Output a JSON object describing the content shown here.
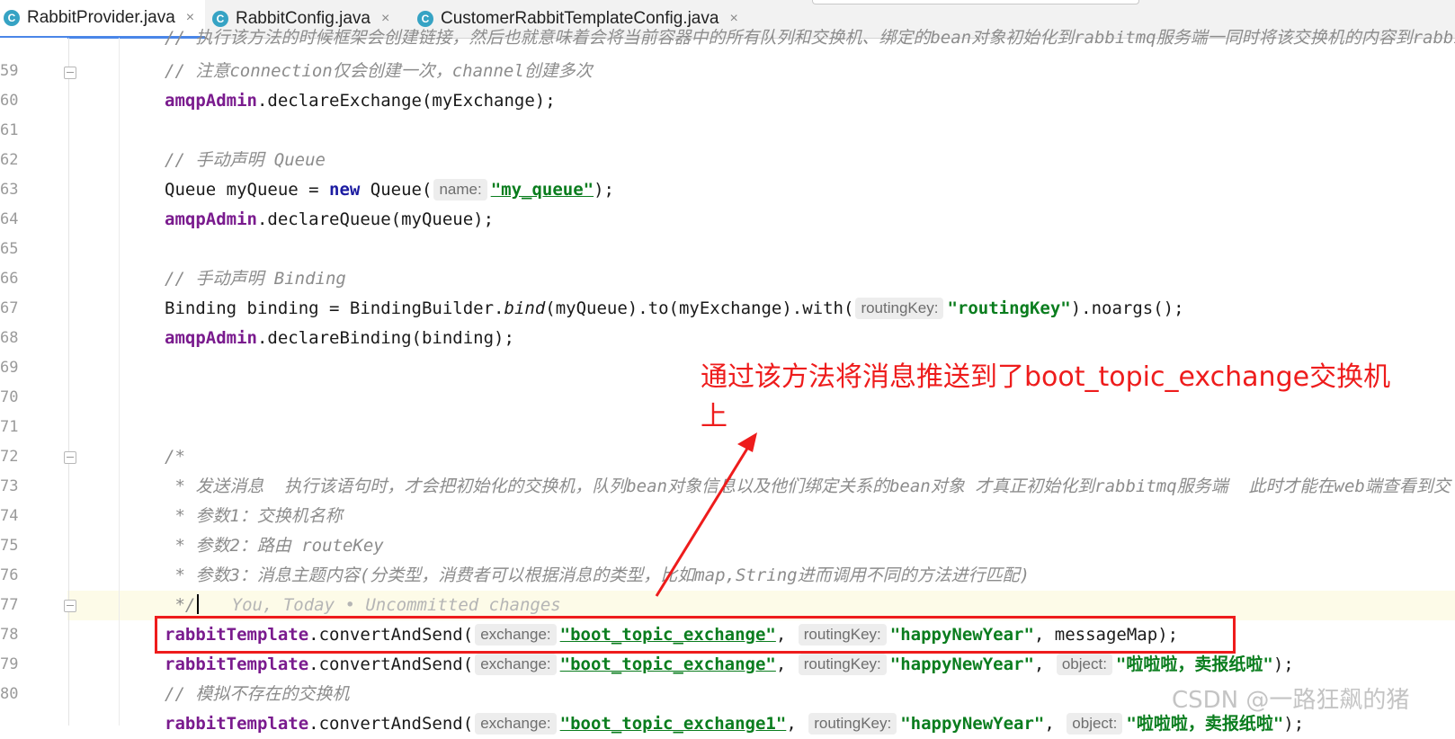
{
  "tabs": [
    {
      "label": "RabbitProvider.java",
      "active": true
    },
    {
      "label": "RabbitConfig.java",
      "active": false
    },
    {
      "label": "CustomerRabbitTemplateConfig.java",
      "active": false
    }
  ],
  "tab_icon_letter": "C",
  "tab_close_glyph": "×",
  "lines": {
    "n59": "59",
    "n60": "60",
    "n61": "61",
    "n62": "62",
    "n63": "63",
    "n64": "64",
    "n65": "65",
    "n66": "66",
    "n67": "67",
    "n68": "68",
    "n69": "69",
    "n70": "70",
    "n71": "71",
    "n72": "72",
    "n73": "73",
    "n74": "74",
    "n75": "75",
    "n76": "76",
    "n77": "77",
    "n78": "78",
    "n79": "79",
    "n80": "80"
  },
  "code": {
    "l58_comment": "// 执行该方法的时候框架会创建链接，然后也就意味着会将当前容器中的所有队列和交换机、绑定的bean对象初始化到rabbitmq服务端一同时将该交换机的内容到rabbit",
    "l59_comment": "// 注意connection仅会创建一次，channel创建多次",
    "l60_obj": "amqpAdmin",
    "l60_rest": ".declareExchange(myExchange);",
    "l62_comment": "// 手动声明 Queue",
    "l63_pre": "Queue myQueue = ",
    "l63_new": "new",
    "l63_mid": " Queue(",
    "l63_hint": "name:",
    "l63_str": "\"my_queue\"",
    "l63_end": ");",
    "l64_obj": "amqpAdmin",
    "l64_rest": ".declareQueue(myQueue);",
    "l66_comment": "// 手动声明 Binding",
    "l67_pre": "Binding binding = BindingBuilder.",
    "l67_bind": "bind",
    "l67_mid": "(myQueue).to(myExchange).with(",
    "l67_hint": "routingKey:",
    "l67_str": "\"routingKey\"",
    "l67_end": ").noargs();",
    "l68_obj": "amqpAdmin",
    "l68_rest": ".declareBinding(binding);",
    "l72": "/*",
    "l73": " * 发送消息  执行该语句时，才会把初始化的交换机，队列bean对象信息以及他们绑定关系的bean对象 才真正初始化到rabbitmq服务端  此时才能在web端查看到交",
    "l74": " * 参数1：交换机名称",
    "l75": " * 参数2：路由 routeKey",
    "l76": " * 参数3：消息主题内容(分类型，消费者可以根据消息的类型，比如map,String进而调用不同的方法进行匹配)",
    "l77_end": " */",
    "l77_blame": "You, Today • Uncommitted changes",
    "l78_obj": "rabbitTemplate",
    "l78_call": ".convertAndSend(",
    "l78_h1": "exchange:",
    "l78_s1": "\"boot_topic_exchange\"",
    "l78_c1": ",",
    "l78_h2": "routingKey:",
    "l78_s2": "\"happyNewYear\"",
    "l78_end": ", messageMap);",
    "l79_obj": "rabbitTemplate",
    "l79_call": ".convertAndSend(",
    "l79_h1": "exchange:",
    "l79_s1": "\"boot_topic_exchange\"",
    "l79_c1": ",",
    "l79_h2": "routingKey:",
    "l79_s2": "\"happyNewYear\"",
    "l79_c2": ",",
    "l79_h3": "object:",
    "l79_s3": "\"啦啦啦，卖报纸啦\"",
    "l79_end": ");",
    "l80_comment": "// 模拟不存在的交换机",
    "l81_obj": "rabbitTemplate",
    "l81_call": ".convertAndSend(",
    "l81_h1": "exchange:",
    "l81_s1": "\"boot_topic_exchange1\"",
    "l81_c1": ",",
    "l81_h2": "routingKey:",
    "l81_s2": "\"happyNewYear\"",
    "l81_c2": ",",
    "l81_h3": "object:",
    "l81_s3": "\"啦啦啦，卖报纸啦\"",
    "l81_end": ");"
  },
  "annotation": {
    "text": "通过该方法将消息推送到了boot_topic_exchange交换机上",
    "color": "#ee1c1c"
  },
  "watermark": "CSDN @一路狂飙的猪"
}
